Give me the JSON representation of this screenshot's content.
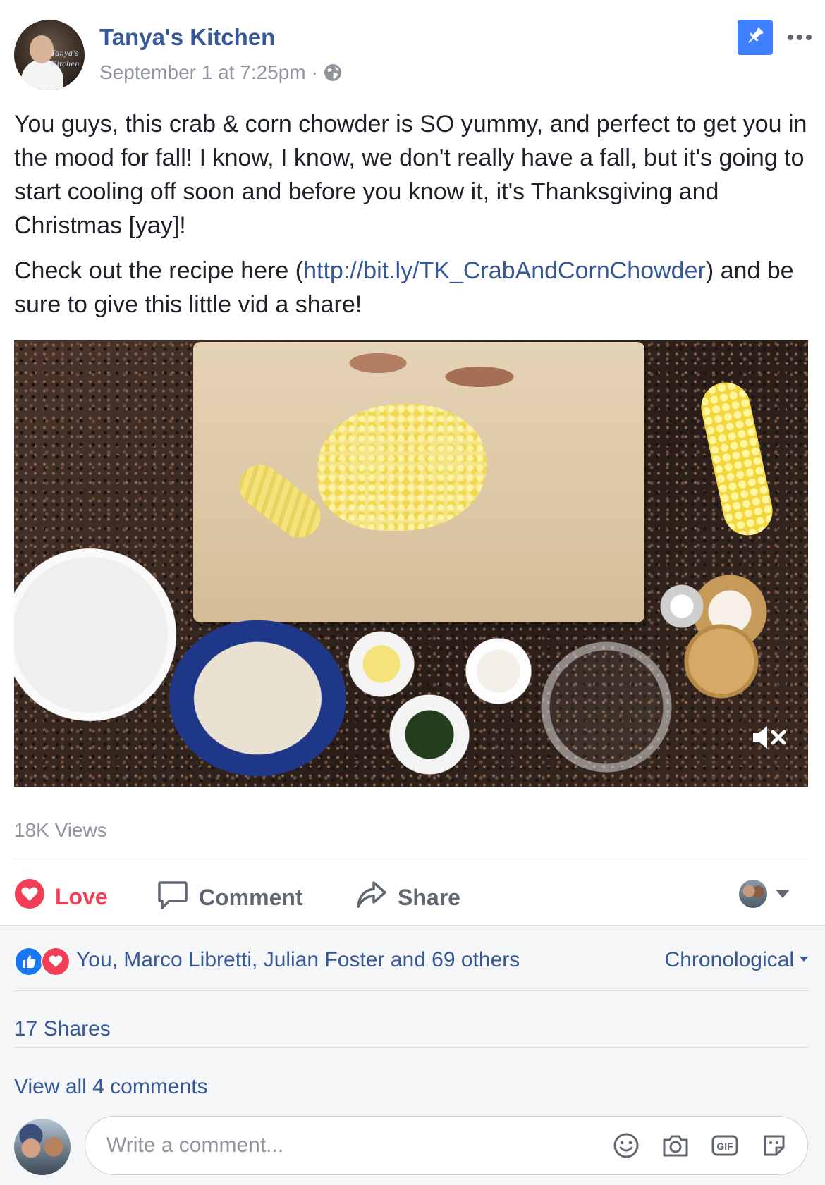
{
  "post": {
    "page_name": "Tanya's Kitchen",
    "timestamp": "September 1 at 7:25pm",
    "separator": "·",
    "avatar_logo": "Tanya's Kitchen",
    "text_p1": "You guys, this crab & corn chowder is SO yummy, and perfect to get you in the mood for fall! I know, I know, we don't really have a fall, but it's going to start cooling off soon and before you know it, it's Thanksgiving and Christmas [yay]!",
    "text_p2_prefix": "Check out the recipe here (",
    "text_p2_link": "http://bit.ly/TK_CrabAndCornChowder",
    "text_p2_suffix": ") and be sure to give this little vid a share!",
    "views": "18K Views"
  },
  "actions": {
    "love_label": "Love",
    "comment_label": "Comment",
    "share_label": "Share"
  },
  "engagement": {
    "reactions_text": "You, Marco Libretti, Julian Foster and 69 others",
    "sort_label": "Chronological",
    "shares_text": "17 Shares",
    "view_comments_text": "View all 4 comments"
  },
  "composer": {
    "placeholder": "Write a comment..."
  },
  "icons": {
    "pin": "pin-icon",
    "more": "more-icon",
    "globe": "globe-icon",
    "mute": "mute-icon",
    "love": "heart-icon",
    "comment": "speech-bubble-icon",
    "share": "share-arrow-icon",
    "emoji": "emoji-icon",
    "camera": "camera-icon",
    "gif": "gif-icon",
    "sticker": "sticker-icon"
  },
  "colors": {
    "link": "#365899",
    "love": "#f33e58",
    "like": "#1877f2",
    "pin": "#4080ff",
    "muted_text": "#90949c"
  }
}
